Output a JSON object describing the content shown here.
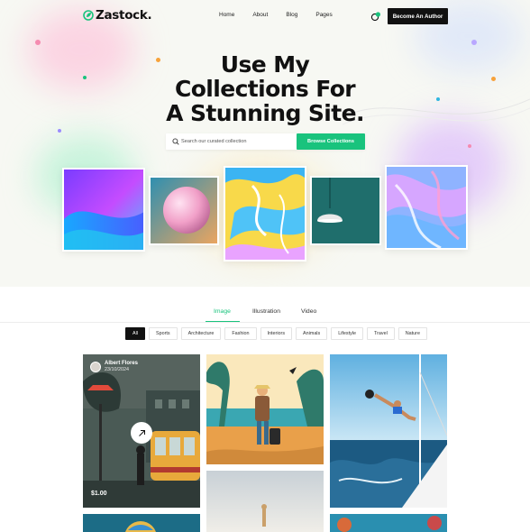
{
  "brand": {
    "name": "Zastock.",
    "accent": "#19c37d",
    "dark": "#111111"
  },
  "nav": {
    "items": [
      "Home",
      "About",
      "Blog",
      "Pages"
    ],
    "cta_label": "Become An Author"
  },
  "hero": {
    "headline_line1": "Use My",
    "headline_line2": "Collections For",
    "headline_line3": "A Stunning Site.",
    "search_placeholder": "Search our curated collection",
    "search_button": "Browse Collections"
  },
  "tabs": {
    "items": [
      "Image",
      "Illustration",
      "Video"
    ],
    "active": "Image"
  },
  "filters": {
    "items": [
      "All",
      "Sports",
      "Architecture",
      "Fashion",
      "Interiors",
      "Animals",
      "Lifestyle",
      "Travel",
      "Nature"
    ],
    "active": "All"
  },
  "gallery": {
    "featured": {
      "author_name": "Albert Flores",
      "author_date": "23/10/2024",
      "price": "$1.00"
    }
  },
  "icons": [
    "leaf-logo-icon",
    "shopping-bag-icon",
    "search-icon",
    "arrow-up-right-icon",
    "avatar"
  ]
}
